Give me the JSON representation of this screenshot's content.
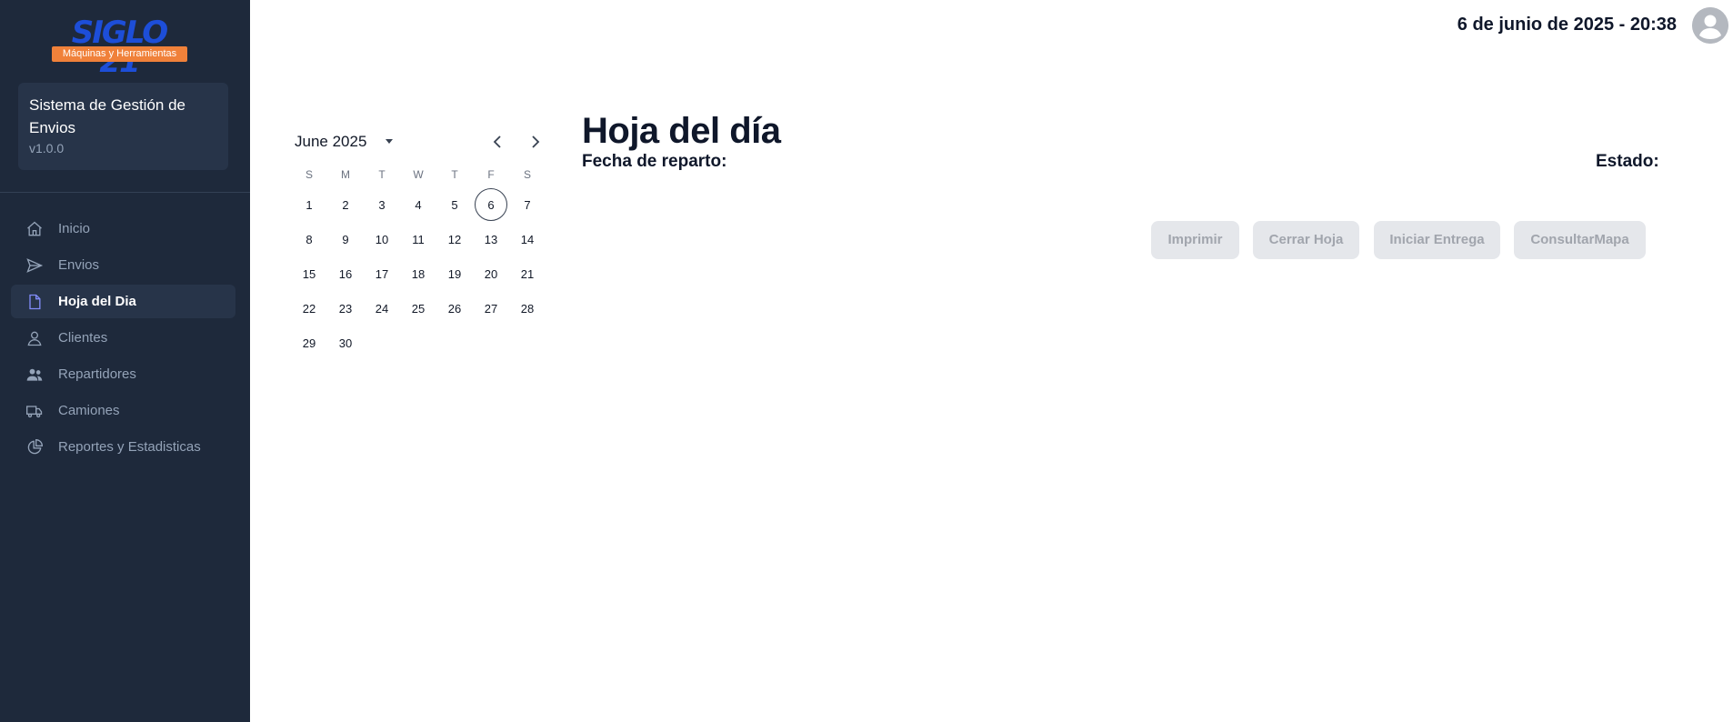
{
  "brand": {
    "logo_text": "SIGLO 21",
    "logo_subtitle": "Máquinas y Herramientas"
  },
  "system": {
    "title": "Sistema de Gestión de Envios",
    "version": "v1.0.0"
  },
  "nav": {
    "items": [
      {
        "label": "Inicio",
        "icon": "home-icon",
        "active": false
      },
      {
        "label": "Envios",
        "icon": "send-icon",
        "active": false
      },
      {
        "label": "Hoja del Dia",
        "icon": "document-icon",
        "active": true
      },
      {
        "label": "Clientes",
        "icon": "user-icon",
        "active": false
      },
      {
        "label": "Repartidores",
        "icon": "users-icon",
        "active": false
      },
      {
        "label": "Camiones",
        "icon": "truck-icon",
        "active": false
      },
      {
        "label": "Reportes y Estadisticas",
        "icon": "pie-chart-icon",
        "active": false
      }
    ]
  },
  "header": {
    "datetime": "6 de junio de 2025 - 20:38"
  },
  "calendar": {
    "month_label": "June 2025",
    "weekdays": [
      "S",
      "M",
      "T",
      "W",
      "T",
      "F",
      "S"
    ],
    "days": [
      "1",
      "2",
      "3",
      "4",
      "5",
      "6",
      "7",
      "8",
      "9",
      "10",
      "11",
      "12",
      "13",
      "14",
      "15",
      "16",
      "17",
      "18",
      "19",
      "20",
      "21",
      "22",
      "23",
      "24",
      "25",
      "26",
      "27",
      "28",
      "29",
      "30"
    ],
    "today": "6"
  },
  "main": {
    "title": "Hoja del día",
    "fecha_label": "Fecha de reparto:",
    "estado_label": "Estado:",
    "buttons": {
      "imprimir": "Imprimir",
      "cerrar": "Cerrar Hoja",
      "iniciar": "Iniciar Entrega",
      "mapa": "ConsultarMapa"
    }
  },
  "colors": {
    "sidebar_bg": "#1e293b",
    "accent": "#818cf8",
    "logo_blue": "#1d4ed8",
    "logo_orange": "#f0813a",
    "button_disabled_bg": "#e5e7eb"
  }
}
